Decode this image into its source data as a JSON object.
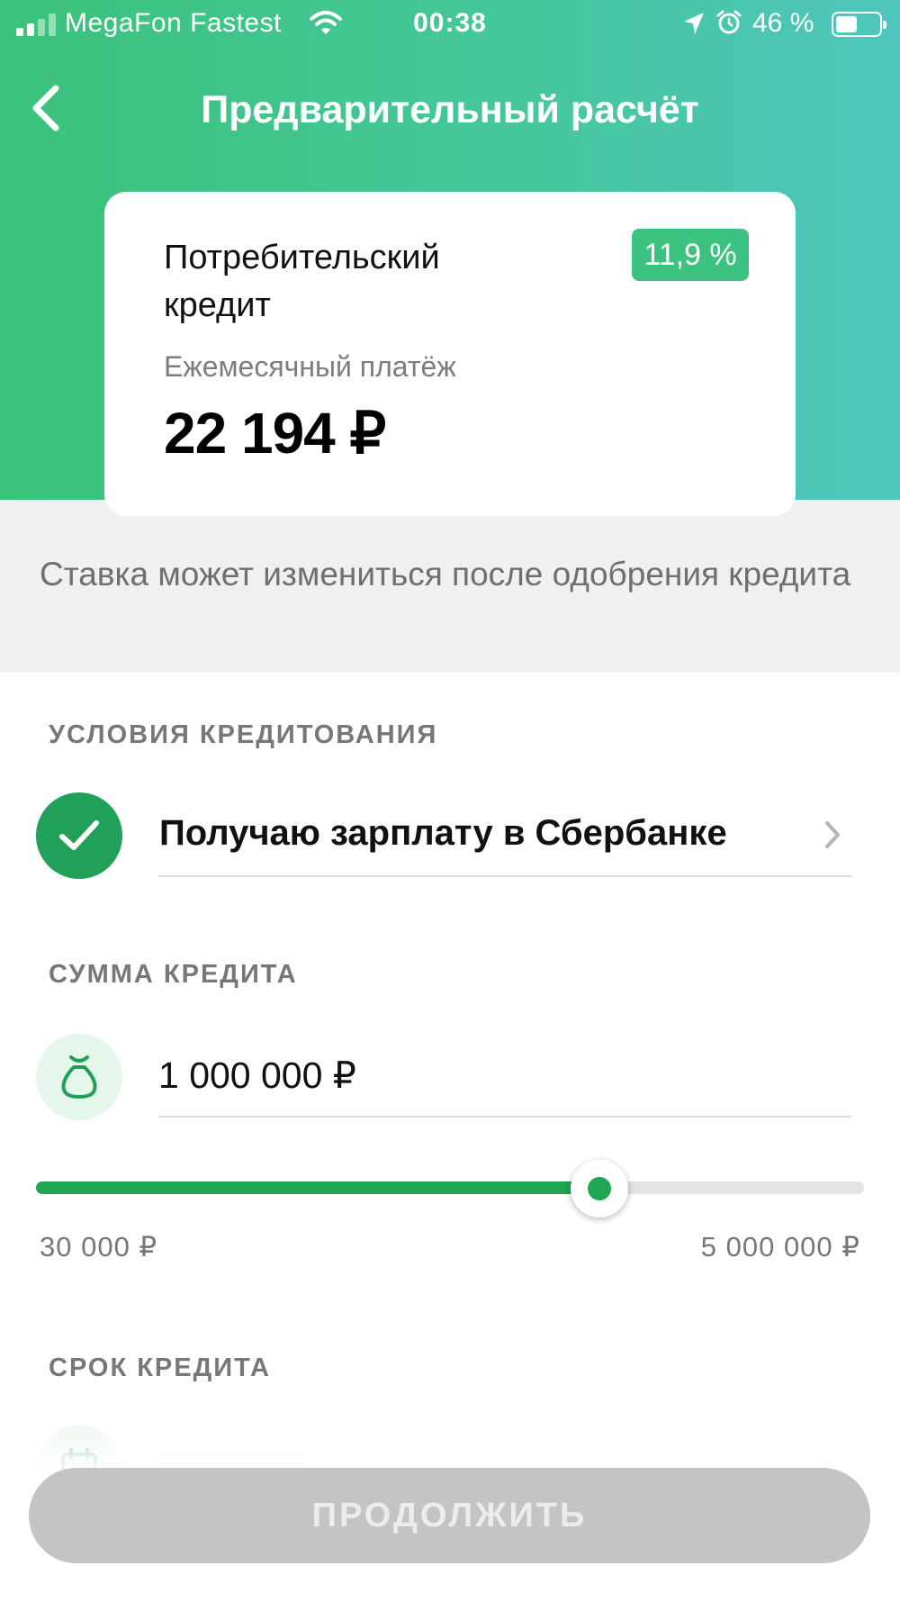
{
  "status_bar": {
    "carrier": "MegaFon Fastest",
    "time": "00:38",
    "battery_percent": "46 %"
  },
  "header": {
    "title": "Предварительный расчёт"
  },
  "card": {
    "product": "Потребительский кредит",
    "rate": "11,9 %",
    "payment_label": "Ежемесячный платёж",
    "payment_value": "22 194 ₽"
  },
  "notice": "Ставка может измениться после одобрения кредита",
  "conditions": {
    "title": "УСЛОВИЯ КРЕДИТОВАНИЯ",
    "salary_label": "Получаю зарплату в Сбербанке",
    "salary_checked": true
  },
  "amount": {
    "title": "СУММА КРЕДИТА",
    "value": "1 000 000 ₽",
    "min_label": "30 000 ₽",
    "max_label": "5 000 000 ₽",
    "slider_fraction": 0.68
  },
  "term": {
    "title": "СРОК КРЕДИТА"
  },
  "continue_label": "ПРОДОЛЖИТЬ",
  "colors": {
    "accent_green": "#21a05a",
    "header_gradient_start": "#3bc27a",
    "header_gradient_end": "#4fc6bd",
    "badge": "#3cc37f",
    "button_disabled": "#c4c4c4"
  }
}
